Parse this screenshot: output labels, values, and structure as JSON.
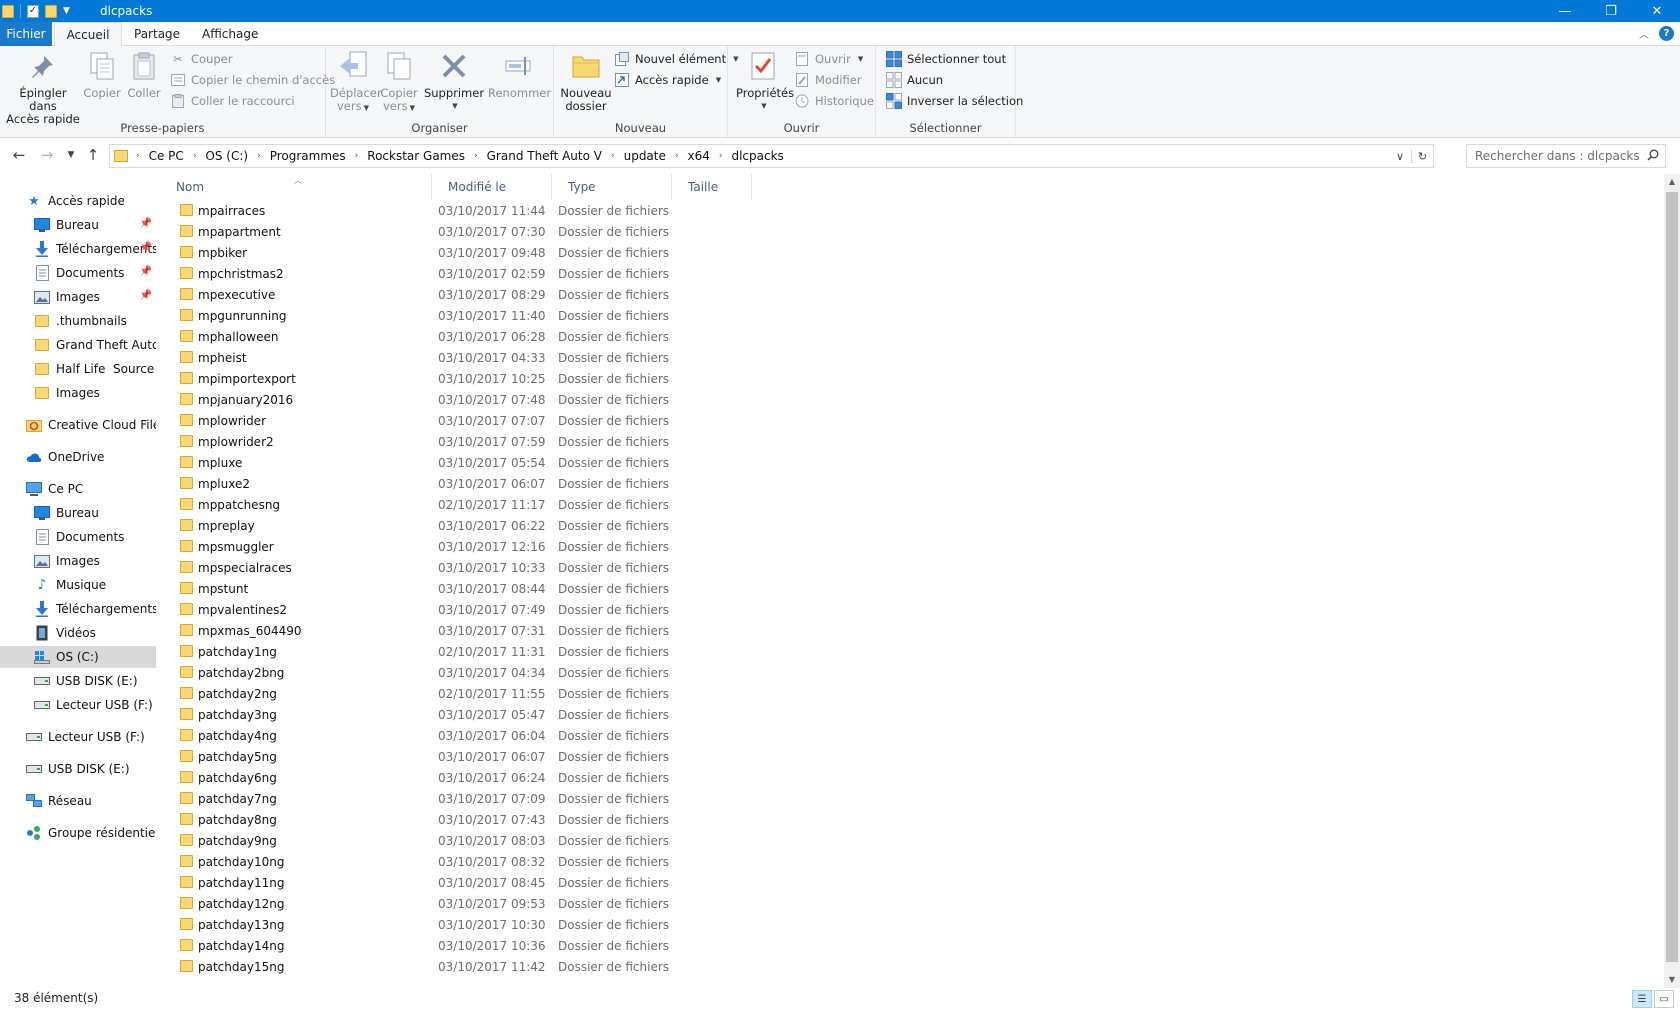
{
  "window": {
    "title": "dlcpacks"
  },
  "ribbon_tabs": {
    "file": "Fichier",
    "home": "Accueil",
    "share": "Partage",
    "view": "Affichage"
  },
  "ribbon": {
    "clipboard": {
      "label": "Presse-papiers",
      "pin_line1": "Épingler dans",
      "pin_line2": "Accès rapide",
      "copy": "Copier",
      "paste": "Coller",
      "cut": "Couper",
      "copy_path": "Copier le chemin d'accès",
      "paste_shortcut": "Coller le raccourci"
    },
    "organize": {
      "label": "Organiser",
      "move_line1": "Déplacer",
      "move_line2": "vers",
      "copy_line1": "Copier",
      "copy_line2": "vers",
      "delete": "Supprimer",
      "rename": "Renommer"
    },
    "new": {
      "label": "Nouveau",
      "new_folder_line1": "Nouveau",
      "new_folder_line2": "dossier",
      "new_item": "Nouvel élément",
      "easy_access": "Accès rapide"
    },
    "open": {
      "label": "Ouvrir",
      "properties": "Propriétés",
      "open": "Ouvrir",
      "edit": "Modifier",
      "history": "Historique"
    },
    "select": {
      "label": "Sélectionner",
      "select_all": "Sélectionner tout",
      "select_none": "Aucun",
      "invert": "Inverser la sélection"
    }
  },
  "address": {
    "crumbs": [
      "Ce PC",
      "OS (C:)",
      "Programmes",
      "Rockstar Games",
      "Grand Theft Auto V",
      "update",
      "x64",
      "dlcpacks"
    ]
  },
  "search": {
    "placeholder": "Rechercher dans : dlcpacks"
  },
  "nav": {
    "quick_access": "Accès rapide",
    "qa_desktop": "Bureau",
    "qa_downloads": "Téléchargements",
    "qa_documents": "Documents",
    "qa_images": "Images",
    "qa_thumbnails": ".thumbnails",
    "qa_gta": "Grand Theft Auto V",
    "qa_halflife": "Half Life  Source",
    "qa_images2": "Images",
    "creative_cloud": "Creative Cloud Files",
    "onedrive": "OneDrive",
    "this_pc": "Ce PC",
    "pc_desktop": "Bureau",
    "pc_documents": "Documents",
    "pc_images": "Images",
    "pc_music": "Musique",
    "pc_downloads": "Téléchargements",
    "pc_videos": "Vidéos",
    "pc_os": "OS (C:)",
    "pc_usb_e": "USB DISK (E:)",
    "pc_usb_f": "Lecteur USB (F:)",
    "usb_f": "Lecteur USB (F:)",
    "usb_e": "USB DISK (E:)",
    "network": "Réseau",
    "homegroup": "Groupe résidentiel"
  },
  "columns": {
    "name": "Nom",
    "modified": "Modifié le",
    "type": "Type",
    "size": "Taille"
  },
  "files": [
    {
      "name": "mpairraces",
      "date": "03/10/2017 11:44",
      "type": "Dossier de fichiers"
    },
    {
      "name": "mpapartment",
      "date": "03/10/2017 07:30",
      "type": "Dossier de fichiers"
    },
    {
      "name": "mpbiker",
      "date": "03/10/2017 09:48",
      "type": "Dossier de fichiers"
    },
    {
      "name": "mpchristmas2",
      "date": "03/10/2017 02:59",
      "type": "Dossier de fichiers"
    },
    {
      "name": "mpexecutive",
      "date": "03/10/2017 08:29",
      "type": "Dossier de fichiers"
    },
    {
      "name": "mpgunrunning",
      "date": "03/10/2017 11:40",
      "type": "Dossier de fichiers"
    },
    {
      "name": "mphalloween",
      "date": "03/10/2017 06:28",
      "type": "Dossier de fichiers"
    },
    {
      "name": "mpheist",
      "date": "03/10/2017 04:33",
      "type": "Dossier de fichiers"
    },
    {
      "name": "mpimportexport",
      "date": "03/10/2017 10:25",
      "type": "Dossier de fichiers"
    },
    {
      "name": "mpjanuary2016",
      "date": "03/10/2017 07:48",
      "type": "Dossier de fichiers"
    },
    {
      "name": "mplowrider",
      "date": "03/10/2017 07:07",
      "type": "Dossier de fichiers"
    },
    {
      "name": "mplowrider2",
      "date": "03/10/2017 07:59",
      "type": "Dossier de fichiers"
    },
    {
      "name": "mpluxe",
      "date": "03/10/2017 05:54",
      "type": "Dossier de fichiers"
    },
    {
      "name": "mpluxe2",
      "date": "03/10/2017 06:07",
      "type": "Dossier de fichiers"
    },
    {
      "name": "mppatchesng",
      "date": "02/10/2017 11:17",
      "type": "Dossier de fichiers"
    },
    {
      "name": "mpreplay",
      "date": "03/10/2017 06:22",
      "type": "Dossier de fichiers"
    },
    {
      "name": "mpsmuggler",
      "date": "03/10/2017 12:16",
      "type": "Dossier de fichiers"
    },
    {
      "name": "mpspecialraces",
      "date": "03/10/2017 10:33",
      "type": "Dossier de fichiers"
    },
    {
      "name": "mpstunt",
      "date": "03/10/2017 08:44",
      "type": "Dossier de fichiers"
    },
    {
      "name": "mpvalentines2",
      "date": "03/10/2017 07:49",
      "type": "Dossier de fichiers"
    },
    {
      "name": "mpxmas_604490",
      "date": "03/10/2017 07:31",
      "type": "Dossier de fichiers"
    },
    {
      "name": "patchday1ng",
      "date": "02/10/2017 11:31",
      "type": "Dossier de fichiers"
    },
    {
      "name": "patchday2bng",
      "date": "03/10/2017 04:34",
      "type": "Dossier de fichiers"
    },
    {
      "name": "patchday2ng",
      "date": "02/10/2017 11:55",
      "type": "Dossier de fichiers"
    },
    {
      "name": "patchday3ng",
      "date": "03/10/2017 05:47",
      "type": "Dossier de fichiers"
    },
    {
      "name": "patchday4ng",
      "date": "03/10/2017 06:04",
      "type": "Dossier de fichiers"
    },
    {
      "name": "patchday5ng",
      "date": "03/10/2017 06:07",
      "type": "Dossier de fichiers"
    },
    {
      "name": "patchday6ng",
      "date": "03/10/2017 06:24",
      "type": "Dossier de fichiers"
    },
    {
      "name": "patchday7ng",
      "date": "03/10/2017 07:09",
      "type": "Dossier de fichiers"
    },
    {
      "name": "patchday8ng",
      "date": "03/10/2017 07:43",
      "type": "Dossier de fichiers"
    },
    {
      "name": "patchday9ng",
      "date": "03/10/2017 08:03",
      "type": "Dossier de fichiers"
    },
    {
      "name": "patchday10ng",
      "date": "03/10/2017 08:32",
      "type": "Dossier de fichiers"
    },
    {
      "name": "patchday11ng",
      "date": "03/10/2017 08:45",
      "type": "Dossier de fichiers"
    },
    {
      "name": "patchday12ng",
      "date": "03/10/2017 09:53",
      "type": "Dossier de fichiers"
    },
    {
      "name": "patchday13ng",
      "date": "03/10/2017 10:30",
      "type": "Dossier de fichiers"
    },
    {
      "name": "patchday14ng",
      "date": "03/10/2017 10:36",
      "type": "Dossier de fichiers"
    },
    {
      "name": "patchday15ng",
      "date": "03/10/2017 11:42",
      "type": "Dossier de fichiers"
    }
  ],
  "status": {
    "count": "38 élément(s)"
  },
  "colors": {
    "accent": "#0078d7",
    "folder": "#f8d775",
    "selected": "#d9d9d9"
  }
}
